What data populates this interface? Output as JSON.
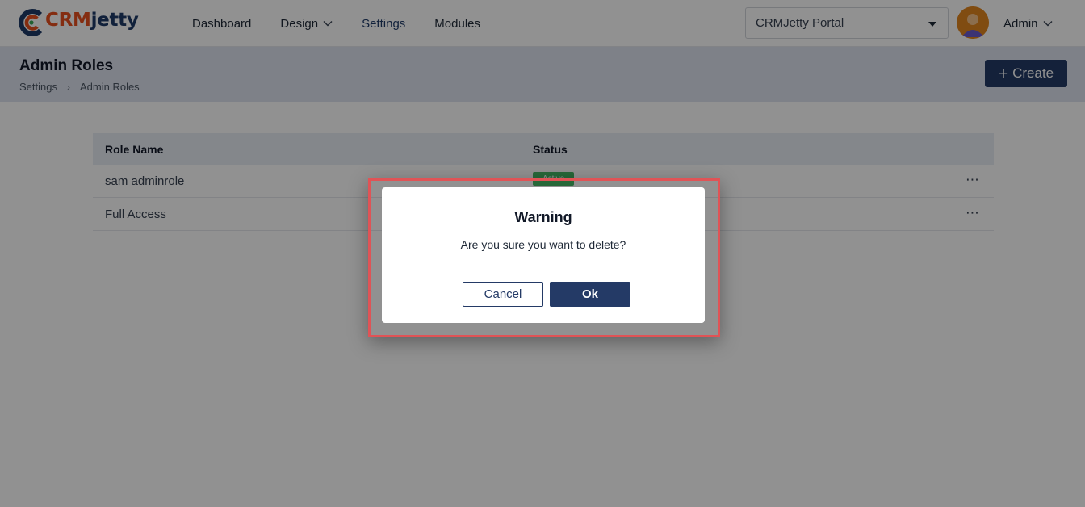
{
  "brand": {
    "part1": "CRM",
    "part2": "jetty"
  },
  "nav": {
    "items": [
      {
        "label": "Dashboard"
      },
      {
        "label": "Design"
      },
      {
        "label": "Settings"
      },
      {
        "label": "Modules"
      }
    ]
  },
  "portal_select": {
    "value": "CRMJetty Portal"
  },
  "user": {
    "name": "Admin"
  },
  "page": {
    "title": "Admin Roles",
    "breadcrumb": [
      "Settings",
      "Admin Roles"
    ],
    "create_label": "Create"
  },
  "table": {
    "headers": {
      "name": "Role Name",
      "status": "Status"
    },
    "rows": [
      {
        "name": "sam adminrole",
        "status": "Active"
      },
      {
        "name": "Full Access",
        "status": ""
      }
    ]
  },
  "dialog": {
    "title": "Warning",
    "message": "Are you sure you want to delete?",
    "cancel_label": "Cancel",
    "ok_label": "Ok"
  },
  "colors": {
    "brand_primary": "#243a66",
    "brand_orange": "#e8501e",
    "status_active": "#46b864",
    "highlight_border": "#e05356"
  }
}
